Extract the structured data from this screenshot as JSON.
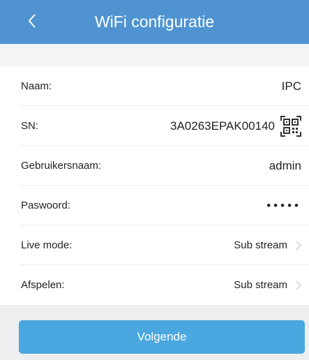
{
  "header": {
    "title": "WiFi configuratie",
    "back_icon": "chevron-left-icon",
    "color": "#4f94d1"
  },
  "fields": {
    "naam": {
      "label": "Naam:",
      "value": "IPC"
    },
    "sn": {
      "label": "SN:",
      "value": "3A0263EPAK00140",
      "icon": "qr-code-icon"
    },
    "gebruikersnaam": {
      "label": "Gebruikersnaam:",
      "value": "admin"
    },
    "paswoord": {
      "label": "Paswoord:",
      "value": "•••••"
    },
    "live_mode": {
      "label": "Live mode:",
      "value": "Sub stream"
    },
    "afspelen": {
      "label": "Afspelen:",
      "value": "Sub stream"
    }
  },
  "footer": {
    "next_label": "Volgende",
    "button_color": "#4aa7df"
  }
}
